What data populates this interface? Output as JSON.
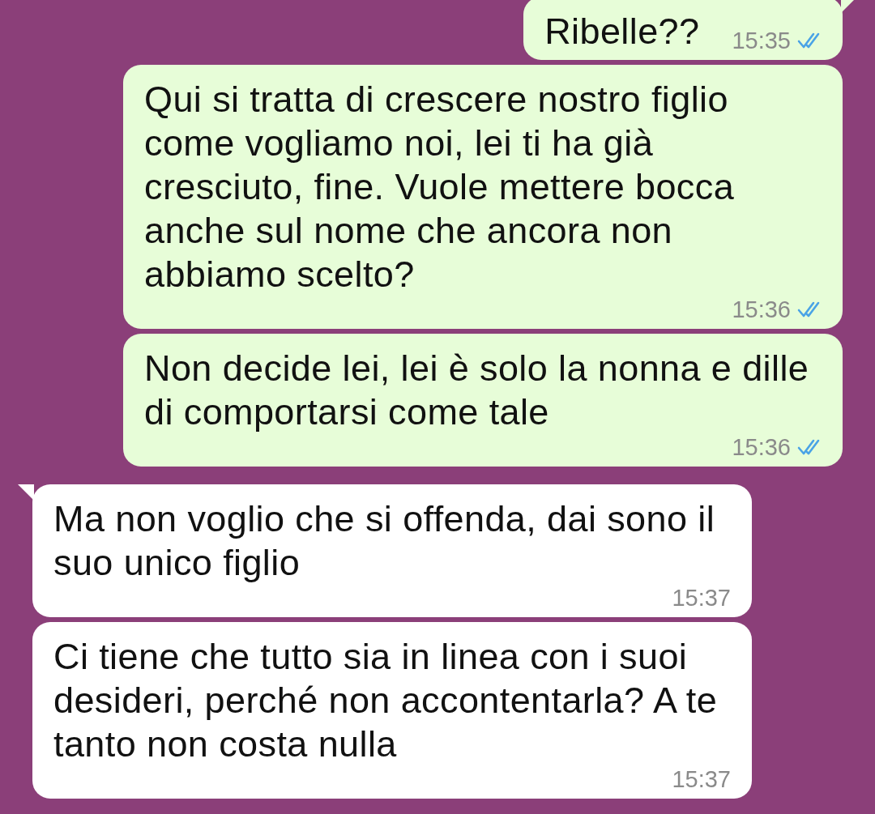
{
  "messages": [
    {
      "kind": "outgoing",
      "tail": true,
      "text": "Ribelle??",
      "time": "15:35",
      "read": true
    },
    {
      "kind": "outgoing",
      "tail": false,
      "text": "Qui si tratta di crescere nostro figlio come vogliamo noi, lei ti ha già cresciuto, fine. Vuole mettere bocca anche sul nome che ancora non abbiamo scelto?",
      "time": "15:36",
      "read": true
    },
    {
      "kind": "outgoing",
      "tail": false,
      "text": "Non decide lei, lei è solo la nonna e dille di comportarsi come tale",
      "time": "15:36",
      "read": true
    },
    {
      "kind": "incoming",
      "tail": true,
      "text": "Ma non voglio che si offenda, dai sono il suo unico figlio",
      "time": "15:37"
    },
    {
      "kind": "incoming",
      "tail": false,
      "text": "Ci tiene che tutto sia in linea con i suoi desideri, perché non accontentarla? A te tanto non costa nulla",
      "time": "15:37"
    }
  ]
}
